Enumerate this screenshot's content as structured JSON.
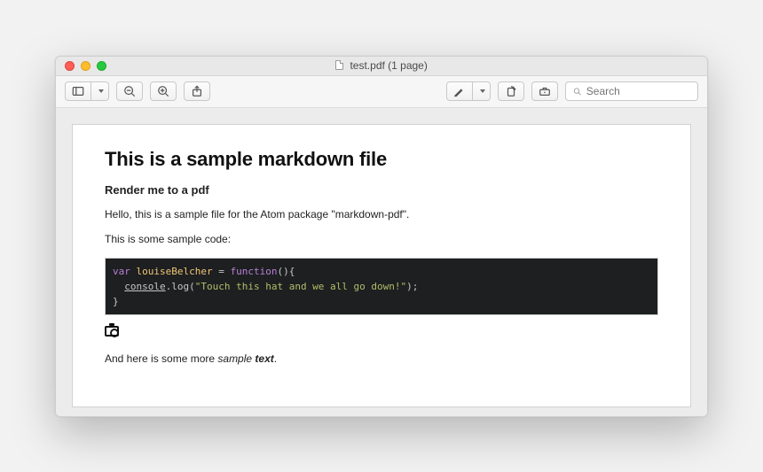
{
  "window": {
    "title": "test.pdf (1 page)"
  },
  "toolbar": {
    "search_placeholder": "Search"
  },
  "doc": {
    "h1": "This is a sample markdown file",
    "h2": "Render me to a pdf",
    "p1": "Hello, this is a sample file for the Atom package \"markdown-pdf\".",
    "p2": "This is some sample code:",
    "code": {
      "kw_var": "var",
      "ident": "louiseBelcher",
      "eq": " = ",
      "kw_func": "function",
      "parens_open": "(){",
      "indent": "  ",
      "console": "console",
      "dot_log": ".log(",
      "string": "\"Touch this hat and we all go down!\"",
      "close_paren": ");",
      "close_brace": "}"
    },
    "p3_prefix": "And here is some more ",
    "p3_italic": "sample ",
    "p3_bolditalic": "text",
    "p3_suffix": "."
  }
}
